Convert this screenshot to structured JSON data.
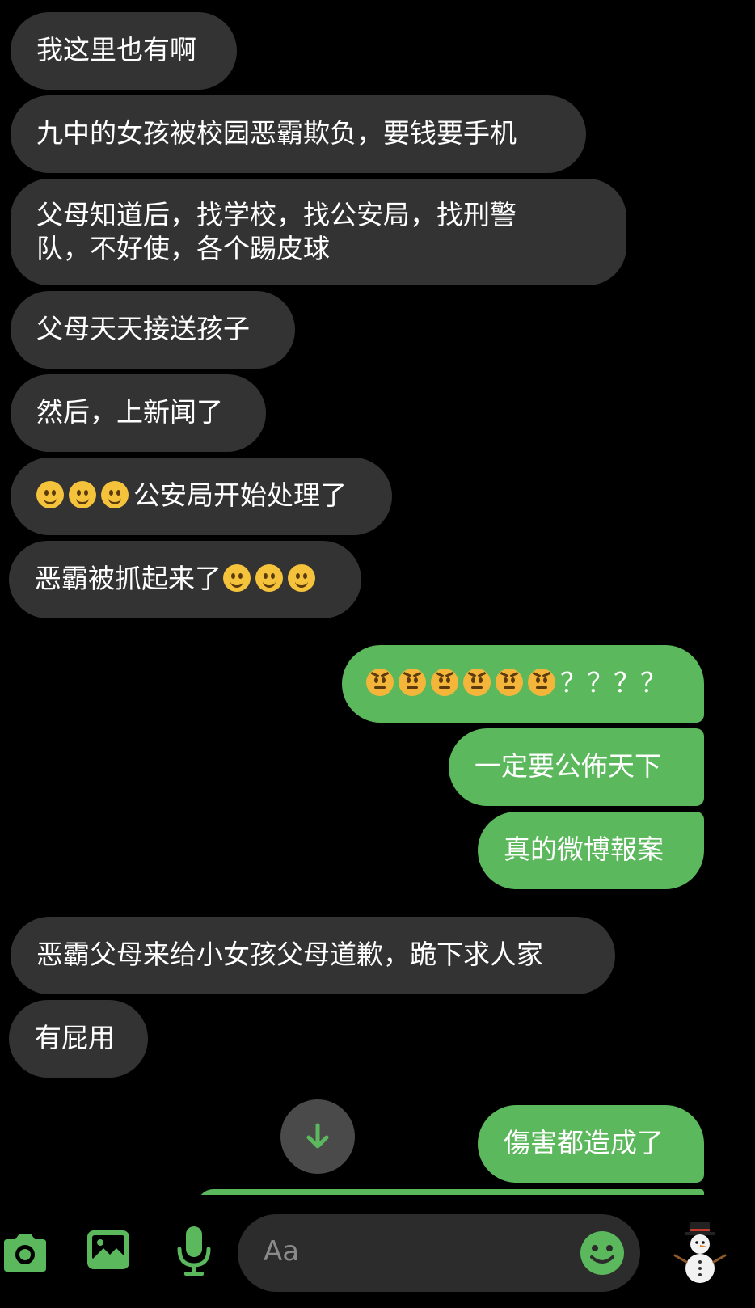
{
  "messages": [
    {
      "dir": "in",
      "text": "我这里也有啊"
    },
    {
      "dir": "in",
      "text": "九中的女孩被校园恶霸欺负，要钱要手机"
    },
    {
      "dir": "in",
      "line1": "父母知道后，找学校，找公安局，找刑警",
      "line2": "队，不好使，各个踢皮球"
    },
    {
      "dir": "in",
      "text": "父母天天接送孩子"
    },
    {
      "dir": "in",
      "text": "然后，上新闻了"
    },
    {
      "dir": "in",
      "text": "公安局开始处理了"
    },
    {
      "dir": "in",
      "text": "恶霸被抓起来了"
    },
    {
      "dir": "out",
      "text": "？？？？"
    },
    {
      "dir": "out",
      "text": "一定要公佈天下"
    },
    {
      "dir": "out",
      "text": "真的微博報案"
    },
    {
      "dir": "in",
      "text": "恶霸父母来给小女孩父母道歉，跪下求人家"
    },
    {
      "dir": "in",
      "text": "有屁用"
    },
    {
      "dir": "out",
      "text": "傷害都造成了"
    }
  ],
  "composer": {
    "placeholder": "Aa",
    "icons": [
      "camera-icon",
      "gallery-icon",
      "microphone-icon",
      "emoji-icon",
      "snowman-sticker-icon"
    ]
  },
  "colors": {
    "incoming": "#333333",
    "outgoing": "#5cb85c",
    "accent": "#5cb85c",
    "background": "#000000"
  }
}
